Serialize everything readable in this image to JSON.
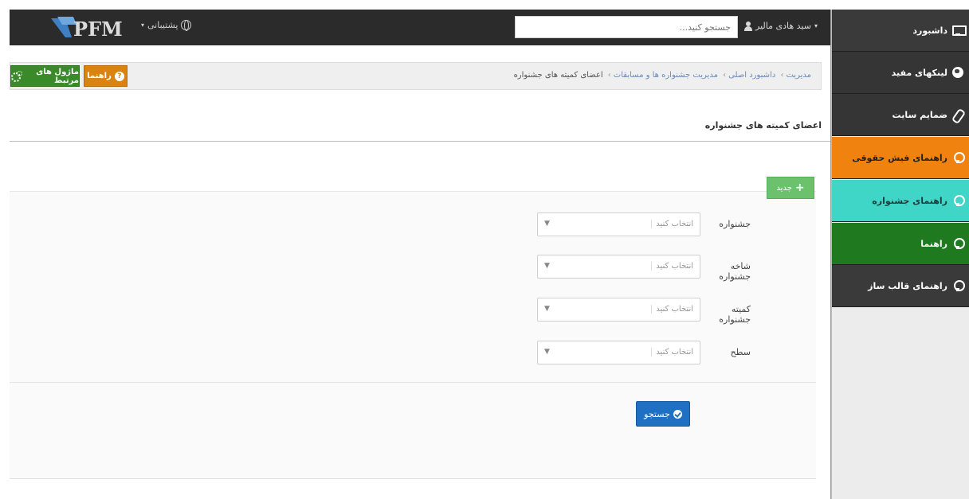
{
  "colors": {
    "topbar": "#2b2b2b",
    "sidebar_dark": "#3a3a3a",
    "sidebar_orange": "#f0820f",
    "sidebar_cyan": "#3fd6c7",
    "sidebar_green": "#1f7a1f",
    "help_button": "#d98311",
    "modules_button": "#3a8a2a",
    "new_button": "#6cc26c",
    "search_button": "#1f6fc2",
    "breadcrumb_link": "#6a8bb8"
  },
  "header": {
    "logo_text": "PFM",
    "support_label": "پشتیبانی",
    "search_placeholder": "جستجو کنید...",
    "user_name": "سید هادی مالیر"
  },
  "sidebar": {
    "items": [
      {
        "label": "داشبورد",
        "icon": "monitor-icon",
        "color": "#3a3a3a"
      },
      {
        "label": "لینکهای مفید",
        "icon": "globe-icon",
        "color": "#353535"
      },
      {
        "label": "ضمایم سایت",
        "icon": "paperclip-icon",
        "color": "#353535"
      },
      {
        "label": "راهنمای فیش حقوقی",
        "icon": "lightbulb-icon",
        "color": "#f0820f"
      },
      {
        "label": "راهنمای جشنواره",
        "icon": "lightbulb-icon",
        "color": "#3fd6c7"
      },
      {
        "label": "راهنما",
        "icon": "lightbulb-icon",
        "color": "#1f7a1f"
      },
      {
        "label": "راهنمای قالب ساز",
        "icon": "lightbulb-icon",
        "color": "#3a3a3a"
      }
    ]
  },
  "breadcrumb": {
    "items": [
      "مدیریت",
      "داشبورد اصلی",
      "مدیریت جشنواره ها و مسابقات"
    ],
    "current": "اعضای کمیته های جشنواره"
  },
  "toolbar": {
    "help_label": "راهنما",
    "modules_label": "ماژول های مرتبط"
  },
  "page": {
    "title": "اعضای کمیته های جشنواره",
    "new_label": "جدید"
  },
  "filters": [
    {
      "label": "جشنواره",
      "placeholder": "انتخاب کنید"
    },
    {
      "label": "شاخه جشنواره",
      "placeholder": "انتخاب کنید"
    },
    {
      "label": "کمیته جشنواره",
      "placeholder": "انتخاب کنید"
    },
    {
      "label": "سطح",
      "placeholder": "انتخاب کنید"
    }
  ],
  "search_label": "جستجو"
}
